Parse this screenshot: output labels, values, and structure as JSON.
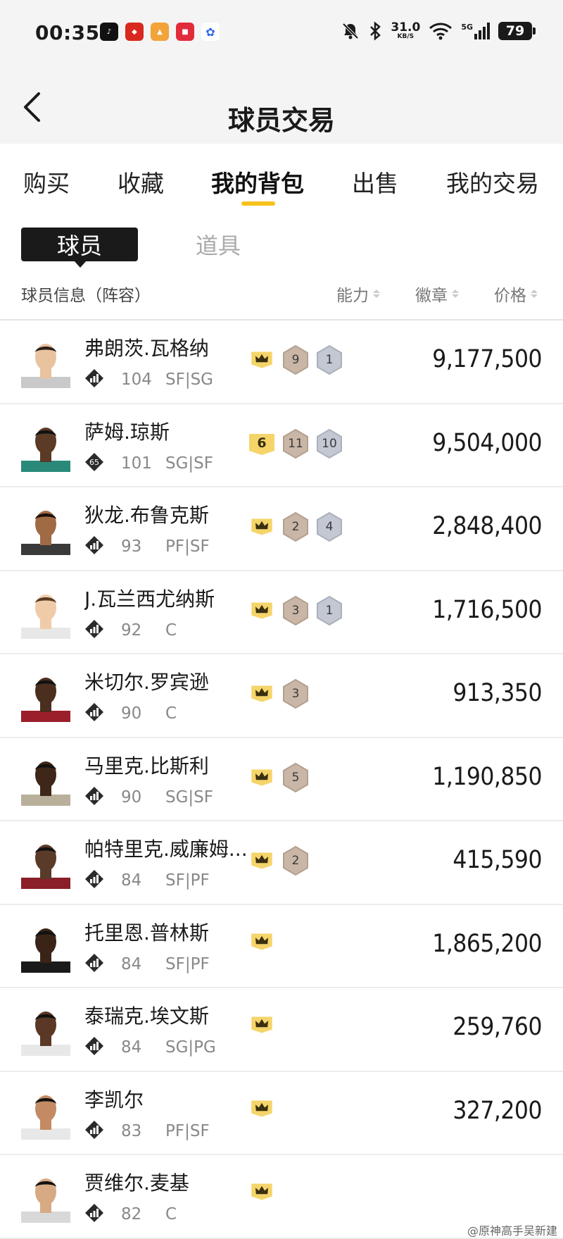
{
  "status_bar": {
    "time": "00:35",
    "net_speed": "31.0",
    "net_unit": "KB/S",
    "network": "5G",
    "battery": "79",
    "icons": [
      "tiktok-icon",
      "app-icon",
      "app-icon",
      "app-icon",
      "baidu-icon",
      "mute-icon",
      "bluetooth-icon",
      "wifi-icon",
      "signal-icon",
      "battery-icon"
    ]
  },
  "header": {
    "title": "球员交易"
  },
  "tabs": [
    {
      "label": "购买"
    },
    {
      "label": "收藏"
    },
    {
      "label": "我的背包",
      "active": true
    },
    {
      "label": "出售"
    },
    {
      "label": "我的交易"
    }
  ],
  "subtabs": {
    "player": "球员",
    "item": "道具"
  },
  "columns": {
    "info": "球员信息（阵容）",
    "ability": "能力",
    "badge": "徽章",
    "price": "价格"
  },
  "players": [
    {
      "name": "弗朗茨.瓦格纳",
      "ovr": "104",
      "pos": "SF|SG",
      "crown": "",
      "gold": "",
      "bronze": "9",
      "silver": "1",
      "price": "9,177,500",
      "rank_icon": ""
    },
    {
      "name": "萨姆.琼斯",
      "ovr": "101",
      "pos": "SG|SF",
      "crown": "",
      "gold": "6",
      "bronze": "11",
      "silver": "10",
      "price": "9,504,000",
      "rank_icon": "65"
    },
    {
      "name": "狄龙.布鲁克斯",
      "ovr": "93",
      "pos": "PF|SF",
      "crown": "",
      "gold": "",
      "bronze": "2",
      "silver": "4",
      "price": "2,848,400",
      "rank_icon": ""
    },
    {
      "name": "J.瓦兰西尤纳斯",
      "ovr": "92",
      "pos": "C",
      "crown": "",
      "gold": "",
      "bronze": "3",
      "silver": "1",
      "price": "1,716,500",
      "rank_icon": ""
    },
    {
      "name": "米切尔.罗宾逊",
      "ovr": "90",
      "pos": "C",
      "crown": "",
      "gold": "",
      "bronze": "3",
      "silver": "",
      "price": "913,350",
      "rank_icon": ""
    },
    {
      "name": "马里克.比斯利",
      "ovr": "90",
      "pos": "SG|SF",
      "crown": "",
      "gold": "",
      "bronze": "5",
      "silver": "",
      "price": "1,190,850",
      "rank_icon": ""
    },
    {
      "name": "帕特里克.威廉姆...",
      "ovr": "84",
      "pos": "SF|PF",
      "crown": "",
      "gold": "",
      "bronze": "2",
      "silver": "",
      "price": "415,590",
      "rank_icon": ""
    },
    {
      "name": "托里恩.普林斯",
      "ovr": "84",
      "pos": "SF|PF",
      "crown": "",
      "gold": "",
      "bronze": "",
      "silver": "",
      "price": "1,865,200",
      "rank_icon": ""
    },
    {
      "name": "泰瑞克.埃文斯",
      "ovr": "84",
      "pos": "SG|PG",
      "crown": "",
      "gold": "",
      "bronze": "",
      "silver": "",
      "price": "259,760",
      "rank_icon": ""
    },
    {
      "name": "李凯尔",
      "ovr": "83",
      "pos": "PF|SF",
      "crown": "",
      "gold": "",
      "bronze": "",
      "silver": "",
      "price": "327,200",
      "rank_icon": ""
    },
    {
      "name": "贾维尔.麦基",
      "ovr": "82",
      "pos": "C",
      "crown": "",
      "gold": "",
      "bronze": "",
      "silver": "",
      "price": "",
      "rank_icon": ""
    }
  ],
  "watermark": "@原神高手吴新建",
  "colors": {
    "accent": "#f6c21b",
    "gold_badge": "#f5d56a",
    "bronze_badge": "#c9b6a6",
    "silver_badge": "#c3c8d2"
  }
}
